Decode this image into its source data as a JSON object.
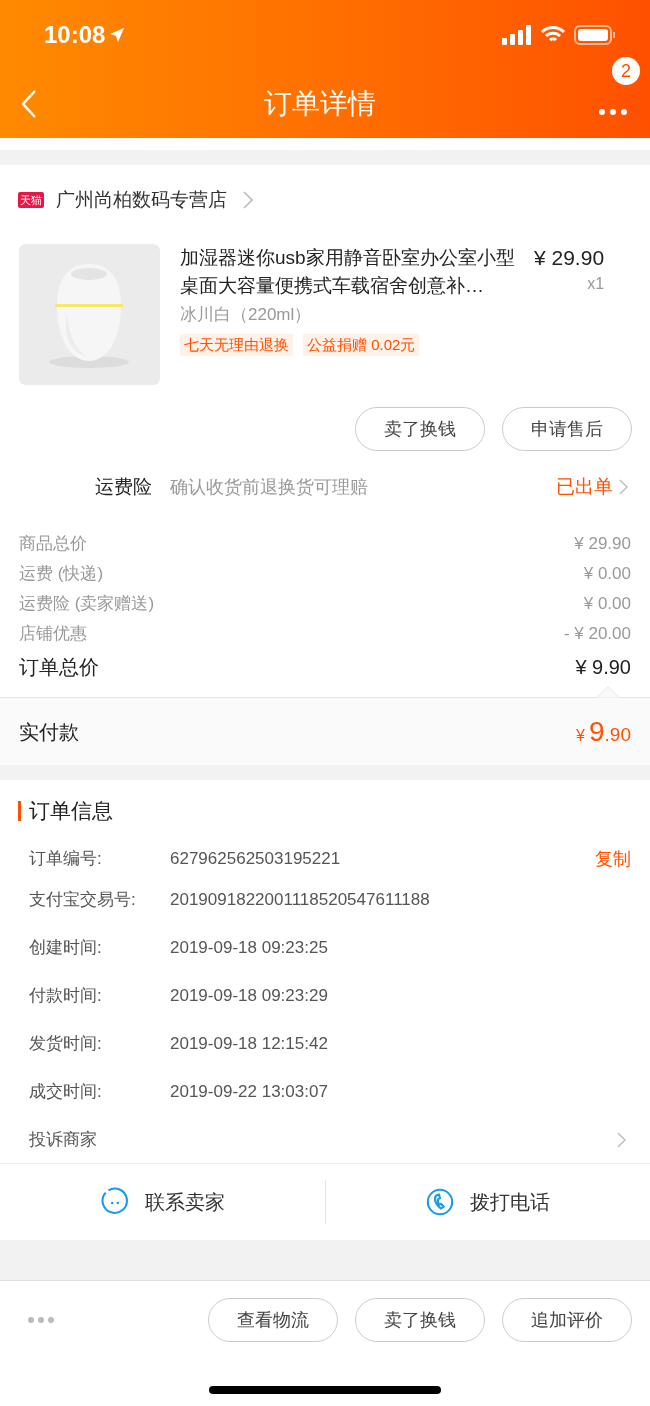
{
  "status_bar": {
    "time": "10:08"
  },
  "nav": {
    "title": "订单详情",
    "badge": "2"
  },
  "store": {
    "badge": "天猫",
    "name": "广州尚柏数码专营店"
  },
  "product": {
    "title": "加湿器迷你usb家用静音卧室办公室小型桌面大容量便携式车载宿舍创意补…",
    "price": "¥ 29.90",
    "quantity": "x1",
    "variant": "冰川白（220ml）",
    "tags": [
      "七天无理由退换",
      "公益捐赠 0.02元"
    ]
  },
  "item_buttons": [
    "卖了换钱",
    "申请售后"
  ],
  "insurance": {
    "label": "运费险",
    "description": "确认收货前退换货可理赔",
    "status": "已出单"
  },
  "costs": [
    {
      "label": "商品总价",
      "value": "¥ 29.90"
    },
    {
      "label": "运费 (快递)",
      "value": "¥ 0.00"
    },
    {
      "label": "运费险 (卖家赠送)",
      "value": "¥ 0.00"
    },
    {
      "label": "店铺优惠",
      "value": "- ¥ 20.00"
    }
  ],
  "total": {
    "label": "订单总价",
    "value": "¥ 9.90"
  },
  "paid": {
    "label": "实付款",
    "currency": "¥",
    "integer": "9",
    "decimal": ".90"
  },
  "order_info": {
    "title": "订单信息",
    "copy": "复制",
    "rows": [
      {
        "label": "订单编号:",
        "value": "627962562503195221"
      },
      {
        "label": "支付宝交易号:",
        "value": "2019091822001118520547611188"
      },
      {
        "label": "创建时间:",
        "value": "2019-09-18 09:23:25"
      },
      {
        "label": "付款时间:",
        "value": "2019-09-18 09:23:29"
      },
      {
        "label": "发货时间:",
        "value": "2019-09-18 12:15:42"
      },
      {
        "label": "成交时间:",
        "value": "2019-09-22 13:03:07"
      }
    ],
    "complaint": "投诉商家"
  },
  "contact": [
    {
      "kind": "chat",
      "label": "联系卖家"
    },
    {
      "kind": "phone",
      "label": "拨打电话"
    }
  ],
  "bottom_buttons": [
    "查看物流",
    "卖了换钱",
    "追加评价"
  ]
}
